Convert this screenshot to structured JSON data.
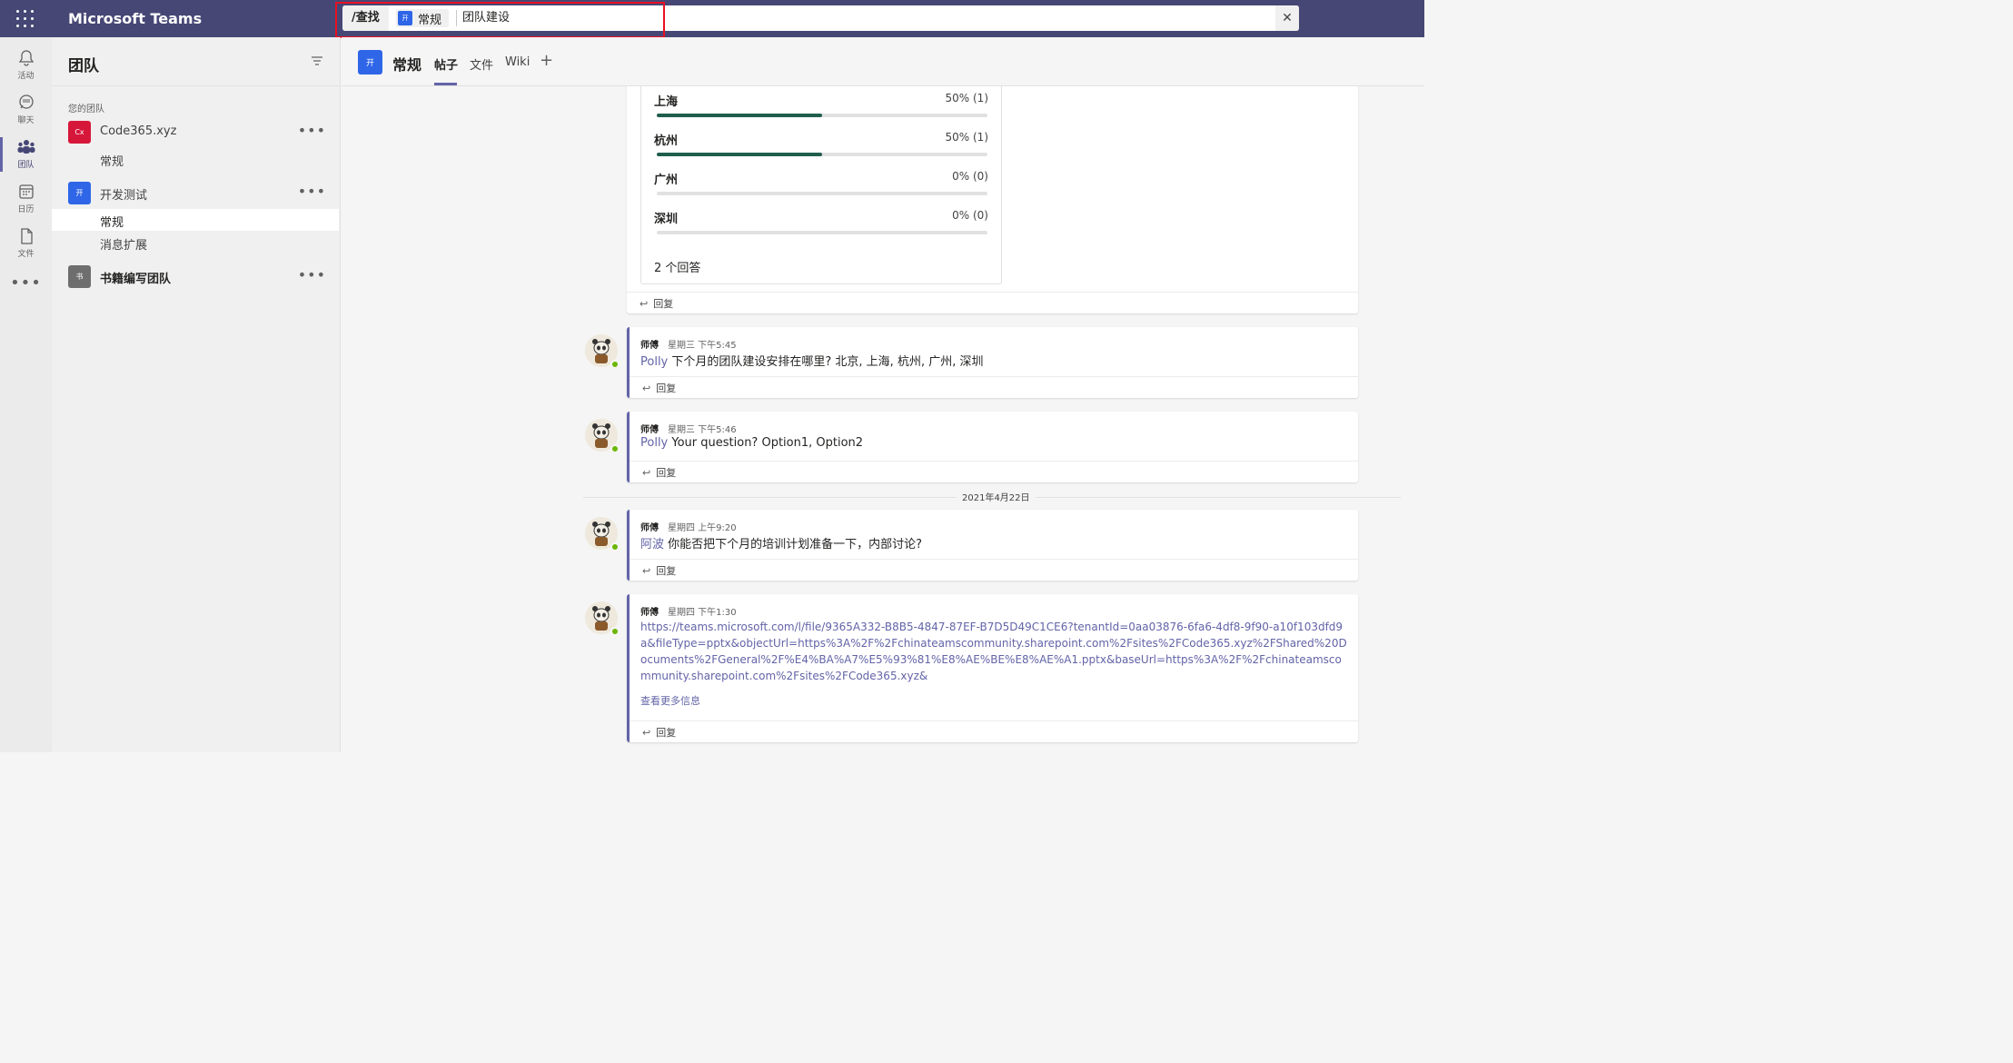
{
  "app": {
    "title": "Microsoft Teams"
  },
  "search": {
    "command": "/查找",
    "chip_label": "常规",
    "chip_icon_text": "开",
    "query": "团队建设"
  },
  "rail": [
    {
      "label": "活动",
      "icon": "bell-icon"
    },
    {
      "label": "聊天",
      "icon": "chat-icon"
    },
    {
      "label": "团队",
      "icon": "teams-icon"
    },
    {
      "label": "日历",
      "icon": "calendar-icon"
    },
    {
      "label": "文件",
      "icon": "file-icon"
    }
  ],
  "panel": {
    "title": "团队",
    "section_label": "您的团队",
    "teams": [
      {
        "name": "Code365.xyz",
        "avatar_text": "Cx",
        "color": "#d6173a",
        "channels": [
          "常规"
        ]
      },
      {
        "name": "开发测试",
        "avatar_text": "开",
        "color": "#2f66e8",
        "channels": [
          "常规",
          "消息扩展"
        ]
      },
      {
        "name": "书籍编写团队",
        "avatar_text": "书",
        "color": "#6e6e6e",
        "channels": []
      }
    ]
  },
  "channel": {
    "avatar_text": "开",
    "title": "常规",
    "tabs": [
      "帖子",
      "文件",
      "Wiki"
    ],
    "active_tab": "帖子"
  },
  "poll": {
    "options": [
      {
        "label": "上海",
        "pct_text": "50% (1)",
        "fraction": 0.5
      },
      {
        "label": "杭州",
        "pct_text": "50% (1)",
        "fraction": 0.5
      },
      {
        "label": "广州",
        "pct_text": "0% (0)",
        "fraction": 0
      },
      {
        "label": "深圳",
        "pct_text": "0% (0)",
        "fraction": 0
      }
    ],
    "responses": "2 个回答",
    "reply_label": "回复"
  },
  "messages": [
    {
      "author": "师傅",
      "time": "星期三 下午5:45",
      "mention": "Polly",
      "text": " 下个月的团队建设安排在哪里? 北京, 上海, 杭州, 广州, 深圳",
      "reply_label": "回复"
    },
    {
      "author": "师傅",
      "time": "星期三 下午5:46",
      "mention": "Polly",
      "text": " Your question? Option1, Option2",
      "reply_label": "回复"
    },
    {
      "author": "师傅",
      "time": "星期四 上午9:20",
      "mention": "阿波",
      "text": " 你能否把下个月的培训计划准备一下，内部讨论?",
      "reply_label": "回复"
    },
    {
      "author": "师傅",
      "time": "星期四 下午1:30",
      "link": "https://teams.microsoft.com/l/file/9365A332-B8B5-4847-87EF-B7D5D49C1CE6?tenantId=0aa03876-6fa6-4df8-9f90-a10f103dfd9a&fileType=pptx&objectUrl=https%3A%2F%2Fchinateamscommunity.sharepoint.com%2Fsites%2FCode365.xyz%2FShared%20Documents%2FGeneral%2F%E4%BA%A7%E5%93%81%E8%AE%BE%E8%AE%A1.pptx&baseUrl=https%3A%2F%2Fchinateamscommunity.sharepoint.com%2Fsites%2FCode365.xyz&",
      "see_more": "查看更多信息",
      "reply_label": "回复"
    }
  ],
  "date_separator": "2021年4月22日"
}
